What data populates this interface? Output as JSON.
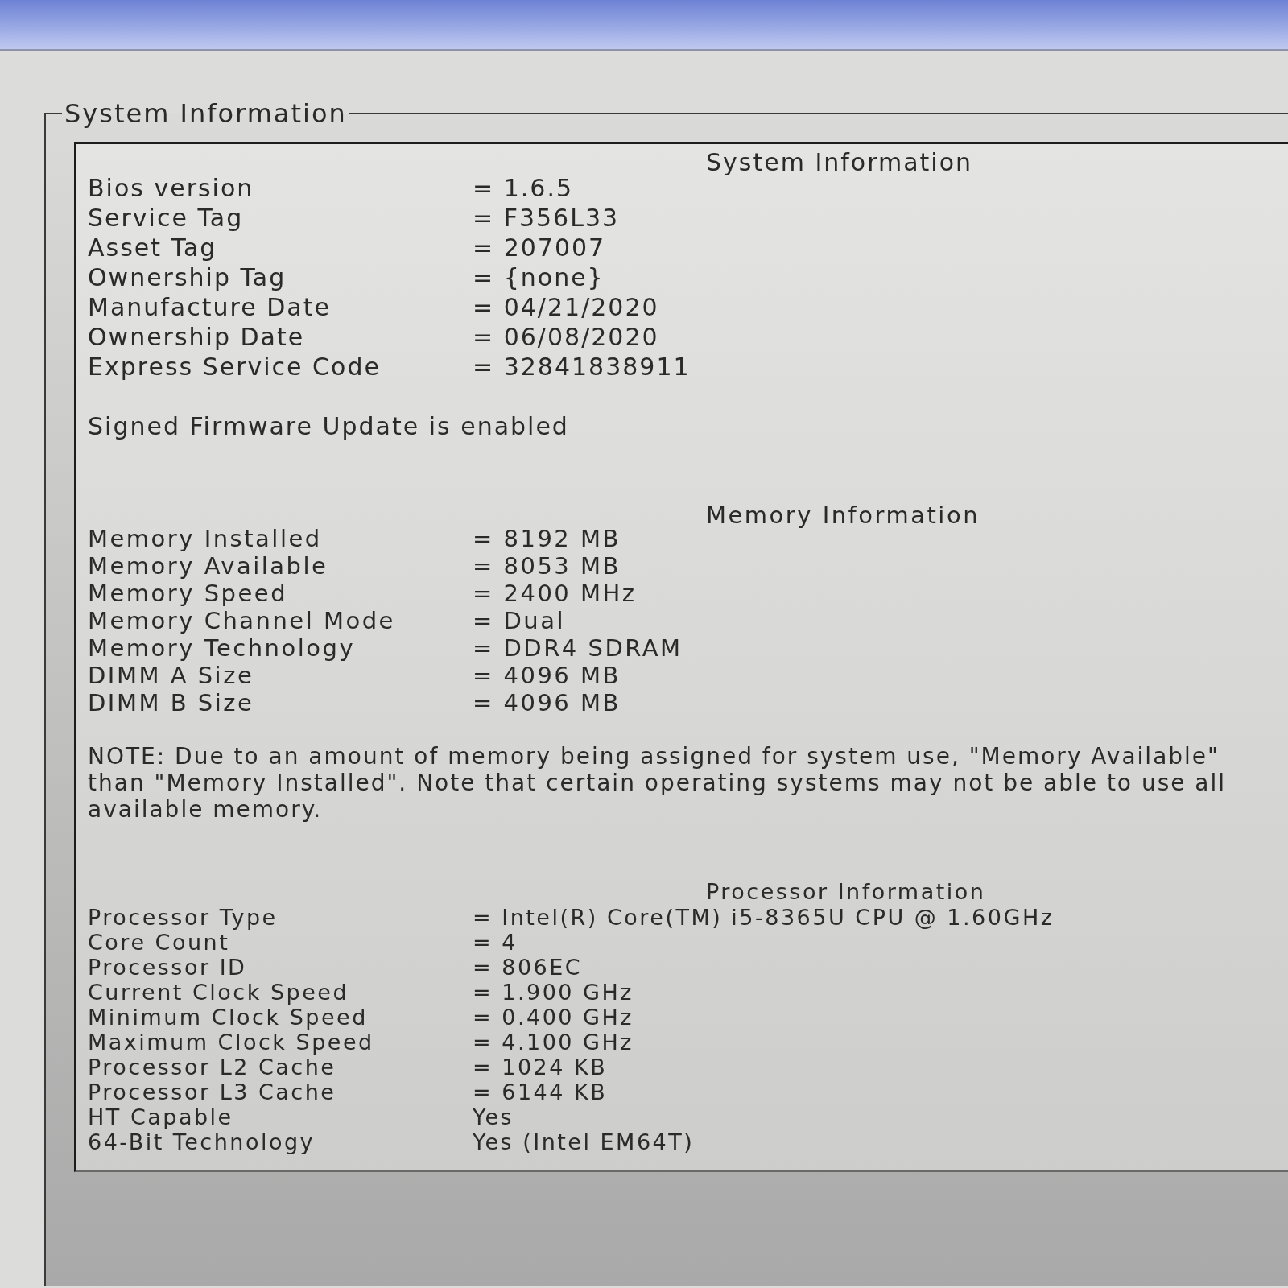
{
  "group_box": {
    "title": "System Information"
  },
  "sections": [
    {
      "heading": "System Information",
      "rows": [
        {
          "label": "Bios version",
          "value": "= 1.6.5"
        },
        {
          "label": "Service Tag",
          "value": "= F356L33"
        },
        {
          "label": "Asset Tag",
          "value": "= 207007"
        },
        {
          "label": "Ownership Tag",
          "value": "= {none}"
        },
        {
          "label": "Manufacture Date",
          "value": "= 04/21/2020"
        },
        {
          "label": "Ownership Date",
          "value": "= 06/08/2020"
        },
        {
          "label": "Express Service Code",
          "value": "= 32841838911"
        }
      ],
      "status": "Signed Firmware Update is enabled"
    },
    {
      "heading": "Memory Information",
      "rows": [
        {
          "label": "Memory Installed",
          "value": "= 8192 MB"
        },
        {
          "label": "Memory Available",
          "value": "= 8053 MB"
        },
        {
          "label": "Memory Speed",
          "value": "= 2400 MHz"
        },
        {
          "label": "Memory Channel Mode",
          "value": "= Dual"
        },
        {
          "label": "Memory Technology",
          "value": "= DDR4 SDRAM"
        },
        {
          "label": "DIMM A Size",
          "value": "= 4096 MB"
        },
        {
          "label": "DIMM B Size",
          "value": "= 4096 MB"
        }
      ],
      "note": [
        "NOTE: Due to an amount of memory being assigned for system use, \"Memory Available\"",
        "than \"Memory Installed\". Note that certain operating systems may not be able to use all",
        "available memory."
      ]
    },
    {
      "heading": "Processor Information",
      "rows": [
        {
          "label": "Processor Type",
          "value": "= Intel(R) Core(TM) i5-8365U CPU @ 1.60GHz"
        },
        {
          "label": "Core Count",
          "value": "= 4"
        },
        {
          "label": "Processor ID",
          "value": "= 806EC"
        },
        {
          "label": "Current Clock Speed",
          "value": "= 1.900 GHz"
        },
        {
          "label": "Minimum Clock Speed",
          "value": "= 0.400 GHz"
        },
        {
          "label": "Maximum Clock Speed",
          "value": "= 4.100 GHz"
        },
        {
          "label": "Processor L2 Cache",
          "value": "= 1024 KB"
        },
        {
          "label": "Processor L3 Cache",
          "value": "= 6144 KB"
        },
        {
          "label": "HT Capable",
          "value": "Yes"
        },
        {
          "label": "64-Bit Technology",
          "value": "Yes (Intel EM64T)"
        }
      ]
    }
  ]
}
